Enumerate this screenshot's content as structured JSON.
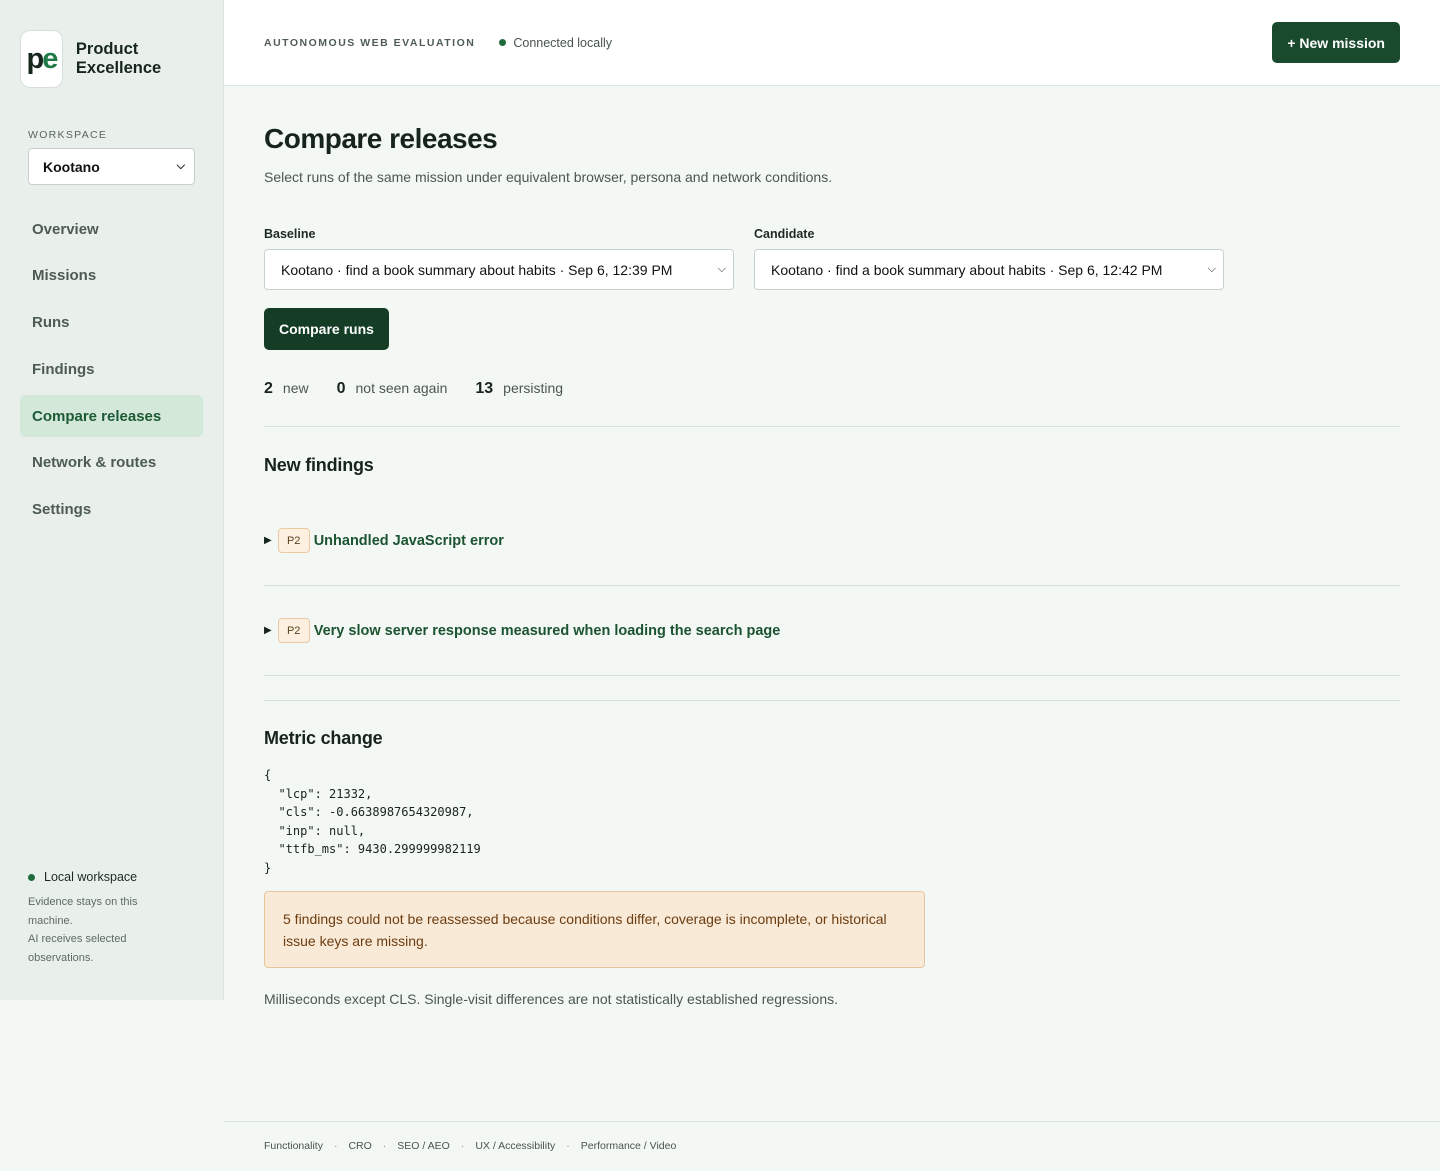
{
  "brand": {
    "logo_text": "pe",
    "name": "Product Excellence"
  },
  "workspace": {
    "label": "WORKSPACE",
    "selected": "Kootano"
  },
  "nav": [
    {
      "label": "Overview",
      "active": false
    },
    {
      "label": "Missions",
      "active": false
    },
    {
      "label": "Runs",
      "active": false
    },
    {
      "label": "Findings",
      "active": false
    },
    {
      "label": "Compare releases",
      "active": true
    },
    {
      "label": "Network & routes",
      "active": false
    },
    {
      "label": "Settings",
      "active": false
    }
  ],
  "sidebar_footer": {
    "title": "Local workspace",
    "line1": "Evidence stays on this machine.",
    "line2": "AI receives selected observations."
  },
  "topbar": {
    "eyebrow": "AUTONOMOUS WEB EVALUATION",
    "status": "Connected locally",
    "new_mission": "+ New mission"
  },
  "page": {
    "title": "Compare releases",
    "subtitle": "Select runs of the same mission under equivalent browser, persona and network conditions."
  },
  "baseline": {
    "label": "Baseline",
    "value": "Kootano · find a book summary about habits · Sep 6, 12:39 PM"
  },
  "candidate": {
    "label": "Candidate",
    "value": "Kootano · find a book summary about habits · Sep 6, 12:42 PM"
  },
  "compare_button": "Compare runs",
  "counts": {
    "new_count": "2",
    "new_label": "new",
    "gone_count": "0",
    "gone_label": "not seen again",
    "persist_count": "13",
    "persist_label": "persisting"
  },
  "new_findings": {
    "heading": "New findings",
    "items": [
      {
        "priority": "P2",
        "title": "Unhandled JavaScript error"
      },
      {
        "priority": "P2",
        "title": "Very slow server response measured when loading the search page"
      }
    ]
  },
  "metric": {
    "heading": "Metric change",
    "json": "{\n  \"lcp\": 21332,\n  \"cls\": -0.6638987654320987,\n  \"inp\": null,\n  \"ttfb_ms\": 9430.299999982119\n}",
    "warning": "5 findings could not be reassessed because conditions differ, coverage is incomplete, or historical issue keys are missing.",
    "note": "Milliseconds except CLS. Single-visit differences are not statistically established regressions."
  },
  "footer": [
    "Functionality",
    "CRO",
    "SEO / AEO",
    "UX / Accessibility",
    "Performance / Video"
  ],
  "colors": {
    "accent": "#1a4a2e",
    "nav_active_bg": "#d3e8d9",
    "warning_bg": "#f9e9d7",
    "badge_bg": "#fdf0e0"
  }
}
